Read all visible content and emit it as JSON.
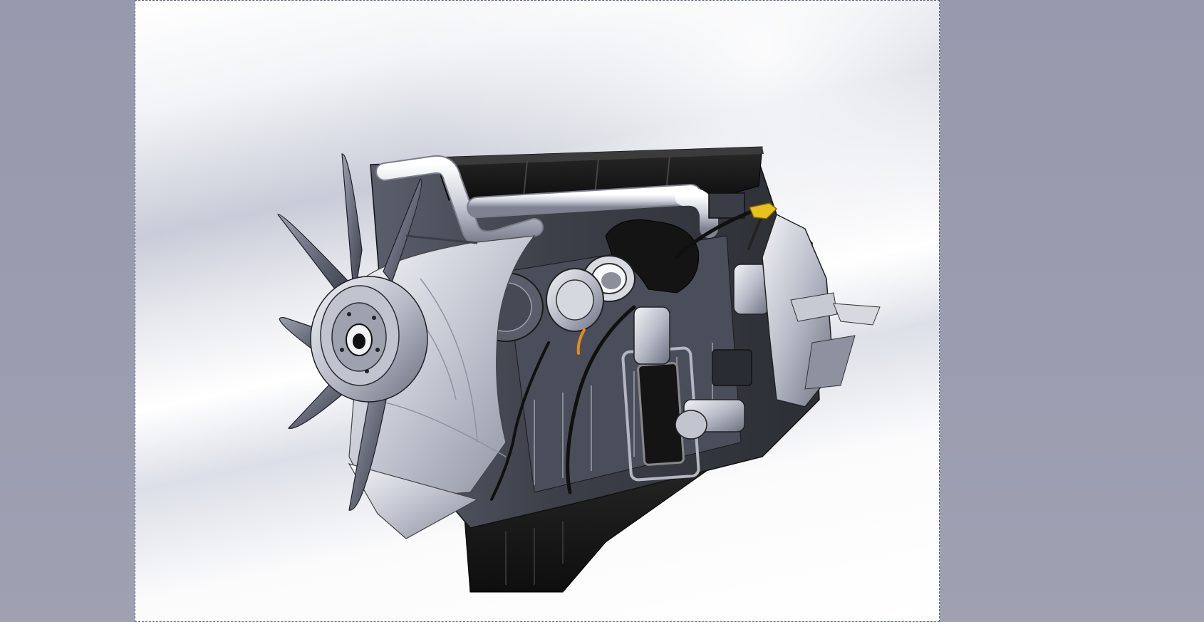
{
  "viewport": {
    "background_color": "#9799ad",
    "sheet_color": "#ffffff",
    "sheet_border_color": "#5a5c78"
  },
  "model": {
    "icon": "engine-model-icon",
    "body_color": "#3a3d45",
    "metal_color": "#c9ccd6",
    "dark_color": "#151515",
    "accent_orange": "#e58a1f",
    "accent_yellow": "#e8c21c"
  }
}
